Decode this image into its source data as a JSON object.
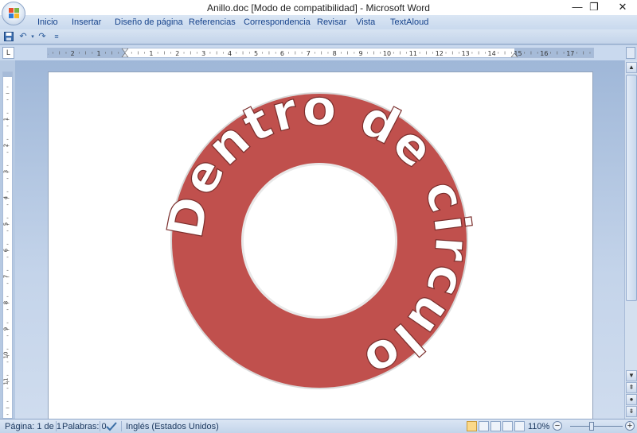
{
  "window": {
    "title": "Anillo.doc [Modo de compatibilidad] - Microsoft Word",
    "minimize": "—",
    "restore": "❐",
    "close": "✕"
  },
  "ribbon_tabs": [
    "Inicio",
    "Insertar",
    "Diseño de página",
    "Referencias",
    "Correspondencia",
    "Revisar",
    "Vista",
    "TextAloud"
  ],
  "quick_access": {
    "save_icon": "save-icon",
    "undo_icon": "undo-icon",
    "redo_icon": "redo-icon",
    "customize_icon": "customize-icon"
  },
  "ruler": {
    "corner_label": "L",
    "h_labels": [
      "3",
      "2",
      "1",
      "1",
      "2",
      "3",
      "4",
      "5",
      "6",
      "7",
      "8",
      "9",
      "10",
      "11",
      "12",
      "13",
      "14",
      "15",
      "16",
      "17"
    ],
    "v_labels": [
      "2",
      "1",
      "1",
      "2",
      "3",
      "4",
      "5",
      "6",
      "7",
      "8",
      "9",
      "10",
      "11"
    ]
  },
  "document": {
    "wordart_text": "Dentro de circulo",
    "ring_color": "#c0504d",
    "text_color": "#ffffff"
  },
  "status": {
    "page": "Página: 1 de 1",
    "words": "Palabras: 0",
    "language": "Inglés (Estados Unidos)",
    "zoom": "110%"
  },
  "colors": {
    "ribbon": "#c9d9ee",
    "accent": "#15428b"
  }
}
